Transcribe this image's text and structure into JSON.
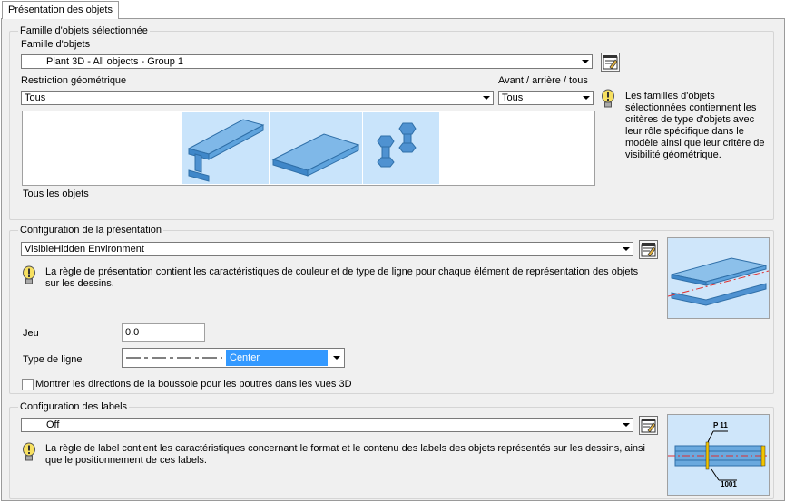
{
  "tab": {
    "label": "Présentation des objets"
  },
  "objfam": {
    "title": "Famille d'objets sélectionnée",
    "family_label": "Famille d'objets",
    "family_value": "Plant 3D - All objects - Group 1",
    "restriction_label": "Restriction géométrique",
    "restriction_value": "Tous",
    "front_back_label": "Avant / arrière / tous",
    "front_back_value": "Tous",
    "info": "Les familles d'objets sélectionnées contiennent les critères de type d'objets avec leur rôle spécifique dans le modèle ainsi que leur critère de visibilité géométrique.",
    "caption": "Tous les objets",
    "icons": [
      "i-beam-icon",
      "plate-icon",
      "bolts-icon"
    ]
  },
  "presentation": {
    "title": "Configuration de la présentation",
    "config_value": "VisibleHidden Environment",
    "info": "La règle de présentation contient les caractéristiques de couleur et de type de ligne pour chaque élément de représentation des objets sur les dessins.",
    "gap_label": "Jeu",
    "gap_value": "0.0",
    "linetype_label": "Type de ligne",
    "linetype_value": "Center",
    "compass_label": "Montrer les directions de la boussole pour les poutres dans les vues 3D",
    "compass_checked": false
  },
  "labels": {
    "title": "Configuration des labels",
    "config_value": "Off",
    "info": "La règle de label contient les caractéristiques concernant le format et le contenu des labels des objets représentés sur les dessins, ainsi que le positionnement de ces labels.",
    "preview_tag_top": "P 11",
    "preview_tag_bottom": "1001"
  },
  "colors": {
    "selection": "#3399ff",
    "panel": "#f0f0f0",
    "icon_blue": "#5b9bd5"
  }
}
